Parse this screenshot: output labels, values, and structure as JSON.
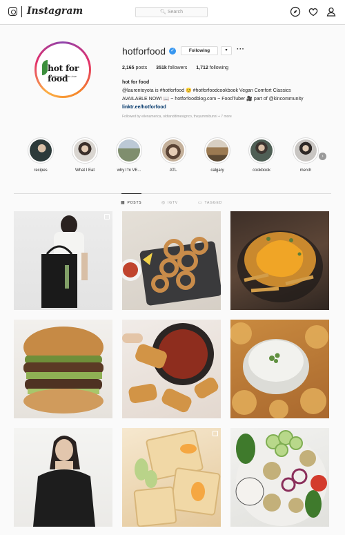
{
  "topbar": {
    "wordmark": "Instagram",
    "search_placeholder": "Search",
    "icons": [
      "instagram-glyph-icon",
      "compass-icon",
      "heart-icon",
      "person-icon"
    ]
  },
  "profile": {
    "username": "hotforfood",
    "verified_mark": "✓",
    "following_button": "Following",
    "dropdown_glyph": "▾",
    "more_glyph": "···",
    "stats": [
      {
        "value": "2,165",
        "label": "posts"
      },
      {
        "value": "351k",
        "label": "followers"
      },
      {
        "value": "1,712",
        "label": "following"
      }
    ],
    "avatar_logo": {
      "text": "hot for food",
      "tagline": "cooking up vegan love"
    },
    "bio": {
      "name": "hot for food",
      "line1": "@laurentoyota is #hotforfood 😊 #hotforfoodcookbook Vegan Comfort Classics",
      "line2": "AVAILABLE NOW! 📖 ~ hotforfoodblog.com ~ FoodTuber 🎥 part of @kincommunity",
      "link": "linktr.ee/hotforfood"
    },
    "followed_by": "Followed by eilenamerica, oldtanddimesignco, theyummibunni + 7 more"
  },
  "highlights": [
    {
      "label": "recipes",
      "color": "#2c3a3a"
    },
    {
      "label": "What I Eat",
      "color": "#8c8a86"
    },
    {
      "label": "why I'm VE...",
      "color": "#7f8e6e"
    },
    {
      "label": "ATL",
      "color": "#c4b09a"
    },
    {
      "label": "calgary",
      "color": "#9b7a52"
    },
    {
      "label": "cookbook",
      "color": "#4f5f55"
    },
    {
      "label": "merch",
      "color": "#c8c5c2"
    }
  ],
  "highlights_next_glyph": "›",
  "tabs": [
    {
      "label": "POSTS",
      "icon": "grid-icon",
      "active": true
    },
    {
      "label": "IGTV",
      "icon": "igtv-icon",
      "active": false
    },
    {
      "label": "TAGGED",
      "icon": "tag-icon",
      "active": false
    }
  ],
  "posts": [
    {
      "subject": "woman with tote bag"
    },
    {
      "subject": "onion rings"
    },
    {
      "subject": "cheese fries"
    },
    {
      "subject": "veggie burger"
    },
    {
      "subject": "spring rolls with dip"
    },
    {
      "subject": "fritters with dip"
    },
    {
      "subject": "woman in black tee"
    },
    {
      "subject": "crepes with fruit"
    },
    {
      "subject": "salad bowl"
    }
  ]
}
